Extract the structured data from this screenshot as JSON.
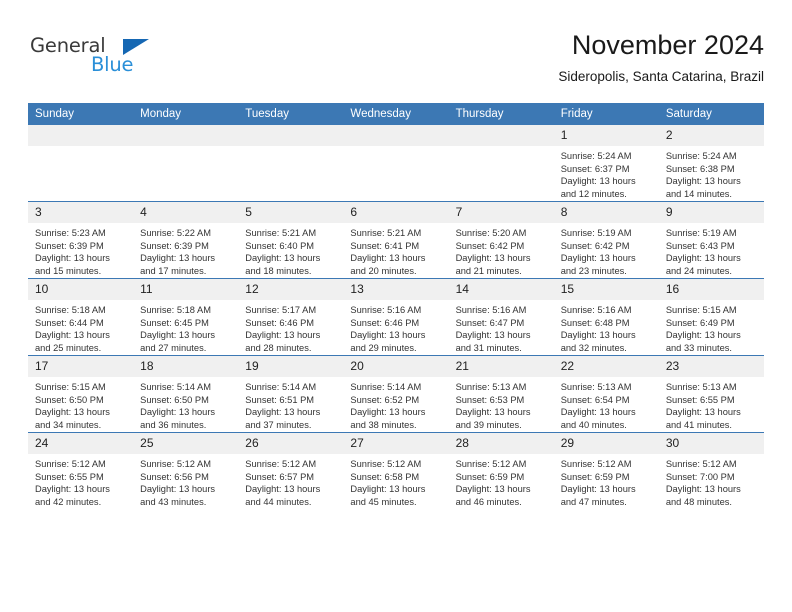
{
  "logo": {
    "word_top": "General",
    "word_bottom": "Blue",
    "triangle_color": "#1567b3",
    "blue_color": "#2a8fd8"
  },
  "header": {
    "title": "November 2024",
    "subtitle": "Sideropolis, Santa Catarina, Brazil"
  },
  "theme": {
    "header_blue": "#3c78b4",
    "daynum_band": "#f0f0f0",
    "text": "#333333"
  },
  "weekdays": [
    "Sunday",
    "Monday",
    "Tuesday",
    "Wednesday",
    "Thursday",
    "Friday",
    "Saturday"
  ],
  "weeks": [
    [
      {
        "day": "",
        "sunrise": "",
        "sunset": "",
        "daylight": "",
        "daylight2": ""
      },
      {
        "day": "",
        "sunrise": "",
        "sunset": "",
        "daylight": "",
        "daylight2": ""
      },
      {
        "day": "",
        "sunrise": "",
        "sunset": "",
        "daylight": "",
        "daylight2": ""
      },
      {
        "day": "",
        "sunrise": "",
        "sunset": "",
        "daylight": "",
        "daylight2": ""
      },
      {
        "day": "",
        "sunrise": "",
        "sunset": "",
        "daylight": "",
        "daylight2": ""
      },
      {
        "day": "1",
        "sunrise": "Sunrise: 5:24 AM",
        "sunset": "Sunset: 6:37 PM",
        "daylight": "Daylight: 13 hours",
        "daylight2": "and 12 minutes."
      },
      {
        "day": "2",
        "sunrise": "Sunrise: 5:24 AM",
        "sunset": "Sunset: 6:38 PM",
        "daylight": "Daylight: 13 hours",
        "daylight2": "and 14 minutes."
      }
    ],
    [
      {
        "day": "3",
        "sunrise": "Sunrise: 5:23 AM",
        "sunset": "Sunset: 6:39 PM",
        "daylight": "Daylight: 13 hours",
        "daylight2": "and 15 minutes."
      },
      {
        "day": "4",
        "sunrise": "Sunrise: 5:22 AM",
        "sunset": "Sunset: 6:39 PM",
        "daylight": "Daylight: 13 hours",
        "daylight2": "and 17 minutes."
      },
      {
        "day": "5",
        "sunrise": "Sunrise: 5:21 AM",
        "sunset": "Sunset: 6:40 PM",
        "daylight": "Daylight: 13 hours",
        "daylight2": "and 18 minutes."
      },
      {
        "day": "6",
        "sunrise": "Sunrise: 5:21 AM",
        "sunset": "Sunset: 6:41 PM",
        "daylight": "Daylight: 13 hours",
        "daylight2": "and 20 minutes."
      },
      {
        "day": "7",
        "sunrise": "Sunrise: 5:20 AM",
        "sunset": "Sunset: 6:42 PM",
        "daylight": "Daylight: 13 hours",
        "daylight2": "and 21 minutes."
      },
      {
        "day": "8",
        "sunrise": "Sunrise: 5:19 AM",
        "sunset": "Sunset: 6:42 PM",
        "daylight": "Daylight: 13 hours",
        "daylight2": "and 23 minutes."
      },
      {
        "day": "9",
        "sunrise": "Sunrise: 5:19 AM",
        "sunset": "Sunset: 6:43 PM",
        "daylight": "Daylight: 13 hours",
        "daylight2": "and 24 minutes."
      }
    ],
    [
      {
        "day": "10",
        "sunrise": "Sunrise: 5:18 AM",
        "sunset": "Sunset: 6:44 PM",
        "daylight": "Daylight: 13 hours",
        "daylight2": "and 25 minutes."
      },
      {
        "day": "11",
        "sunrise": "Sunrise: 5:18 AM",
        "sunset": "Sunset: 6:45 PM",
        "daylight": "Daylight: 13 hours",
        "daylight2": "and 27 minutes."
      },
      {
        "day": "12",
        "sunrise": "Sunrise: 5:17 AM",
        "sunset": "Sunset: 6:46 PM",
        "daylight": "Daylight: 13 hours",
        "daylight2": "and 28 minutes."
      },
      {
        "day": "13",
        "sunrise": "Sunrise: 5:16 AM",
        "sunset": "Sunset: 6:46 PM",
        "daylight": "Daylight: 13 hours",
        "daylight2": "and 29 minutes."
      },
      {
        "day": "14",
        "sunrise": "Sunrise: 5:16 AM",
        "sunset": "Sunset: 6:47 PM",
        "daylight": "Daylight: 13 hours",
        "daylight2": "and 31 minutes."
      },
      {
        "day": "15",
        "sunrise": "Sunrise: 5:16 AM",
        "sunset": "Sunset: 6:48 PM",
        "daylight": "Daylight: 13 hours",
        "daylight2": "and 32 minutes."
      },
      {
        "day": "16",
        "sunrise": "Sunrise: 5:15 AM",
        "sunset": "Sunset: 6:49 PM",
        "daylight": "Daylight: 13 hours",
        "daylight2": "and 33 minutes."
      }
    ],
    [
      {
        "day": "17",
        "sunrise": "Sunrise: 5:15 AM",
        "sunset": "Sunset: 6:50 PM",
        "daylight": "Daylight: 13 hours",
        "daylight2": "and 34 minutes."
      },
      {
        "day": "18",
        "sunrise": "Sunrise: 5:14 AM",
        "sunset": "Sunset: 6:50 PM",
        "daylight": "Daylight: 13 hours",
        "daylight2": "and 36 minutes."
      },
      {
        "day": "19",
        "sunrise": "Sunrise: 5:14 AM",
        "sunset": "Sunset: 6:51 PM",
        "daylight": "Daylight: 13 hours",
        "daylight2": "and 37 minutes."
      },
      {
        "day": "20",
        "sunrise": "Sunrise: 5:14 AM",
        "sunset": "Sunset: 6:52 PM",
        "daylight": "Daylight: 13 hours",
        "daylight2": "and 38 minutes."
      },
      {
        "day": "21",
        "sunrise": "Sunrise: 5:13 AM",
        "sunset": "Sunset: 6:53 PM",
        "daylight": "Daylight: 13 hours",
        "daylight2": "and 39 minutes."
      },
      {
        "day": "22",
        "sunrise": "Sunrise: 5:13 AM",
        "sunset": "Sunset: 6:54 PM",
        "daylight": "Daylight: 13 hours",
        "daylight2": "and 40 minutes."
      },
      {
        "day": "23",
        "sunrise": "Sunrise: 5:13 AM",
        "sunset": "Sunset: 6:55 PM",
        "daylight": "Daylight: 13 hours",
        "daylight2": "and 41 minutes."
      }
    ],
    [
      {
        "day": "24",
        "sunrise": "Sunrise: 5:12 AM",
        "sunset": "Sunset: 6:55 PM",
        "daylight": "Daylight: 13 hours",
        "daylight2": "and 42 minutes."
      },
      {
        "day": "25",
        "sunrise": "Sunrise: 5:12 AM",
        "sunset": "Sunset: 6:56 PM",
        "daylight": "Daylight: 13 hours",
        "daylight2": "and 43 minutes."
      },
      {
        "day": "26",
        "sunrise": "Sunrise: 5:12 AM",
        "sunset": "Sunset: 6:57 PM",
        "daylight": "Daylight: 13 hours",
        "daylight2": "and 44 minutes."
      },
      {
        "day": "27",
        "sunrise": "Sunrise: 5:12 AM",
        "sunset": "Sunset: 6:58 PM",
        "daylight": "Daylight: 13 hours",
        "daylight2": "and 45 minutes."
      },
      {
        "day": "28",
        "sunrise": "Sunrise: 5:12 AM",
        "sunset": "Sunset: 6:59 PM",
        "daylight": "Daylight: 13 hours",
        "daylight2": "and 46 minutes."
      },
      {
        "day": "29",
        "sunrise": "Sunrise: 5:12 AM",
        "sunset": "Sunset: 6:59 PM",
        "daylight": "Daylight: 13 hours",
        "daylight2": "and 47 minutes."
      },
      {
        "day": "30",
        "sunrise": "Sunrise: 5:12 AM",
        "sunset": "Sunset: 7:00 PM",
        "daylight": "Daylight: 13 hours",
        "daylight2": "and 48 minutes."
      }
    ]
  ]
}
